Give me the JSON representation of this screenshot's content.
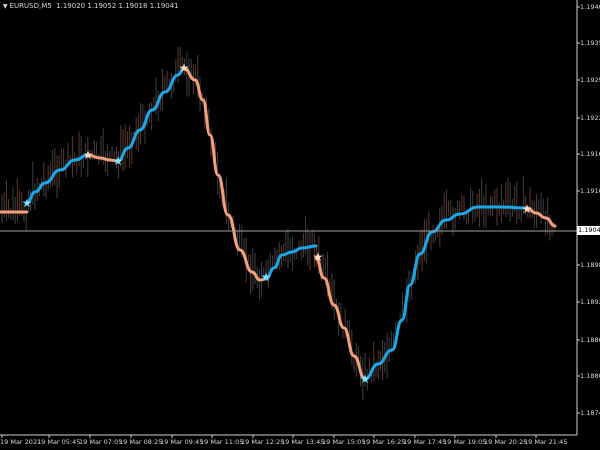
{
  "header": {
    "dropdown_icon": "triangle-down-icon",
    "symbol_timeframe": "EURUSD,M5",
    "ohlc": "1.19020 1.19052 1.19018 1.19041"
  },
  "price_axis": {
    "labels": [
      "1.19405",
      "1.19350",
      "1.19295",
      "1.19225",
      "1.19165",
      "1.19105",
      "1.18985",
      "1.18925",
      "1.18865",
      "1.18805",
      "1.18745"
    ]
  },
  "current_price": {
    "label": "1.19041"
  },
  "time_axis": {
    "labels": [
      "19 Mar 2021",
      "19 Mar 05:45",
      "19 Mar 07:05",
      "19 Mar 08:25",
      "19 Mar 09:45",
      "19 Mar 11:05",
      "19 Mar 12:25",
      "19 Mar 13:45",
      "19 Mar 15:05",
      "19 Mar 16:25",
      "19 Mar 17:45",
      "19 Mar 19:05",
      "19 Mar 20:25",
      "19 Mar 21:45"
    ]
  },
  "colors": {
    "background": "#000000",
    "bull_line": "#1ea7e8",
    "bear_line": "#f4a07e",
    "star": "#f0d0b0",
    "axis": "#cfcfcf",
    "current_price_line": "#a0a0a0",
    "bars": "#6b4a3a"
  }
}
